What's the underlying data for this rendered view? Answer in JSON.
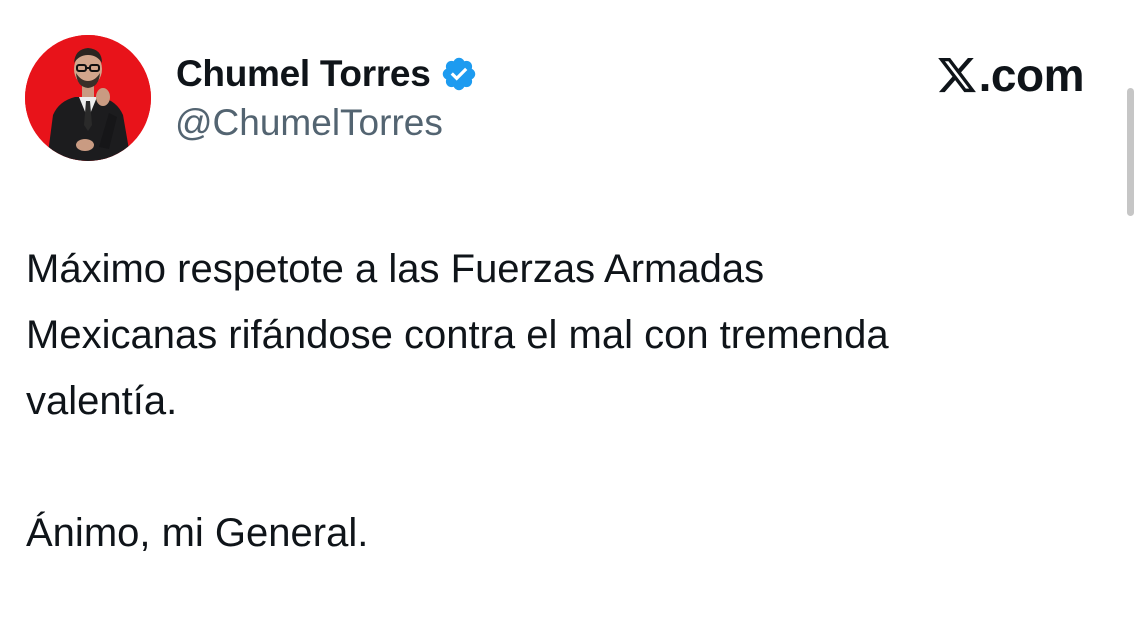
{
  "author": {
    "display_name": "Chumel Torres",
    "handle": "@ChumelTorres",
    "verified": true,
    "verified_icon": "verified-badge-icon",
    "avatar_background": "#e8131a"
  },
  "site": {
    "logo_icon": "x-logo-icon",
    "text": ".com"
  },
  "tweet": {
    "lines": [
      "Máximo respetote a las Fuerzas Armadas",
      "Mexicanas rifándose contra el mal con tremenda",
      "valentía.",
      "Ánimo, mi General."
    ]
  },
  "colors": {
    "text": "#0f1419",
    "secondary_text": "#536471",
    "verified_blue": "#1d9bf0"
  }
}
